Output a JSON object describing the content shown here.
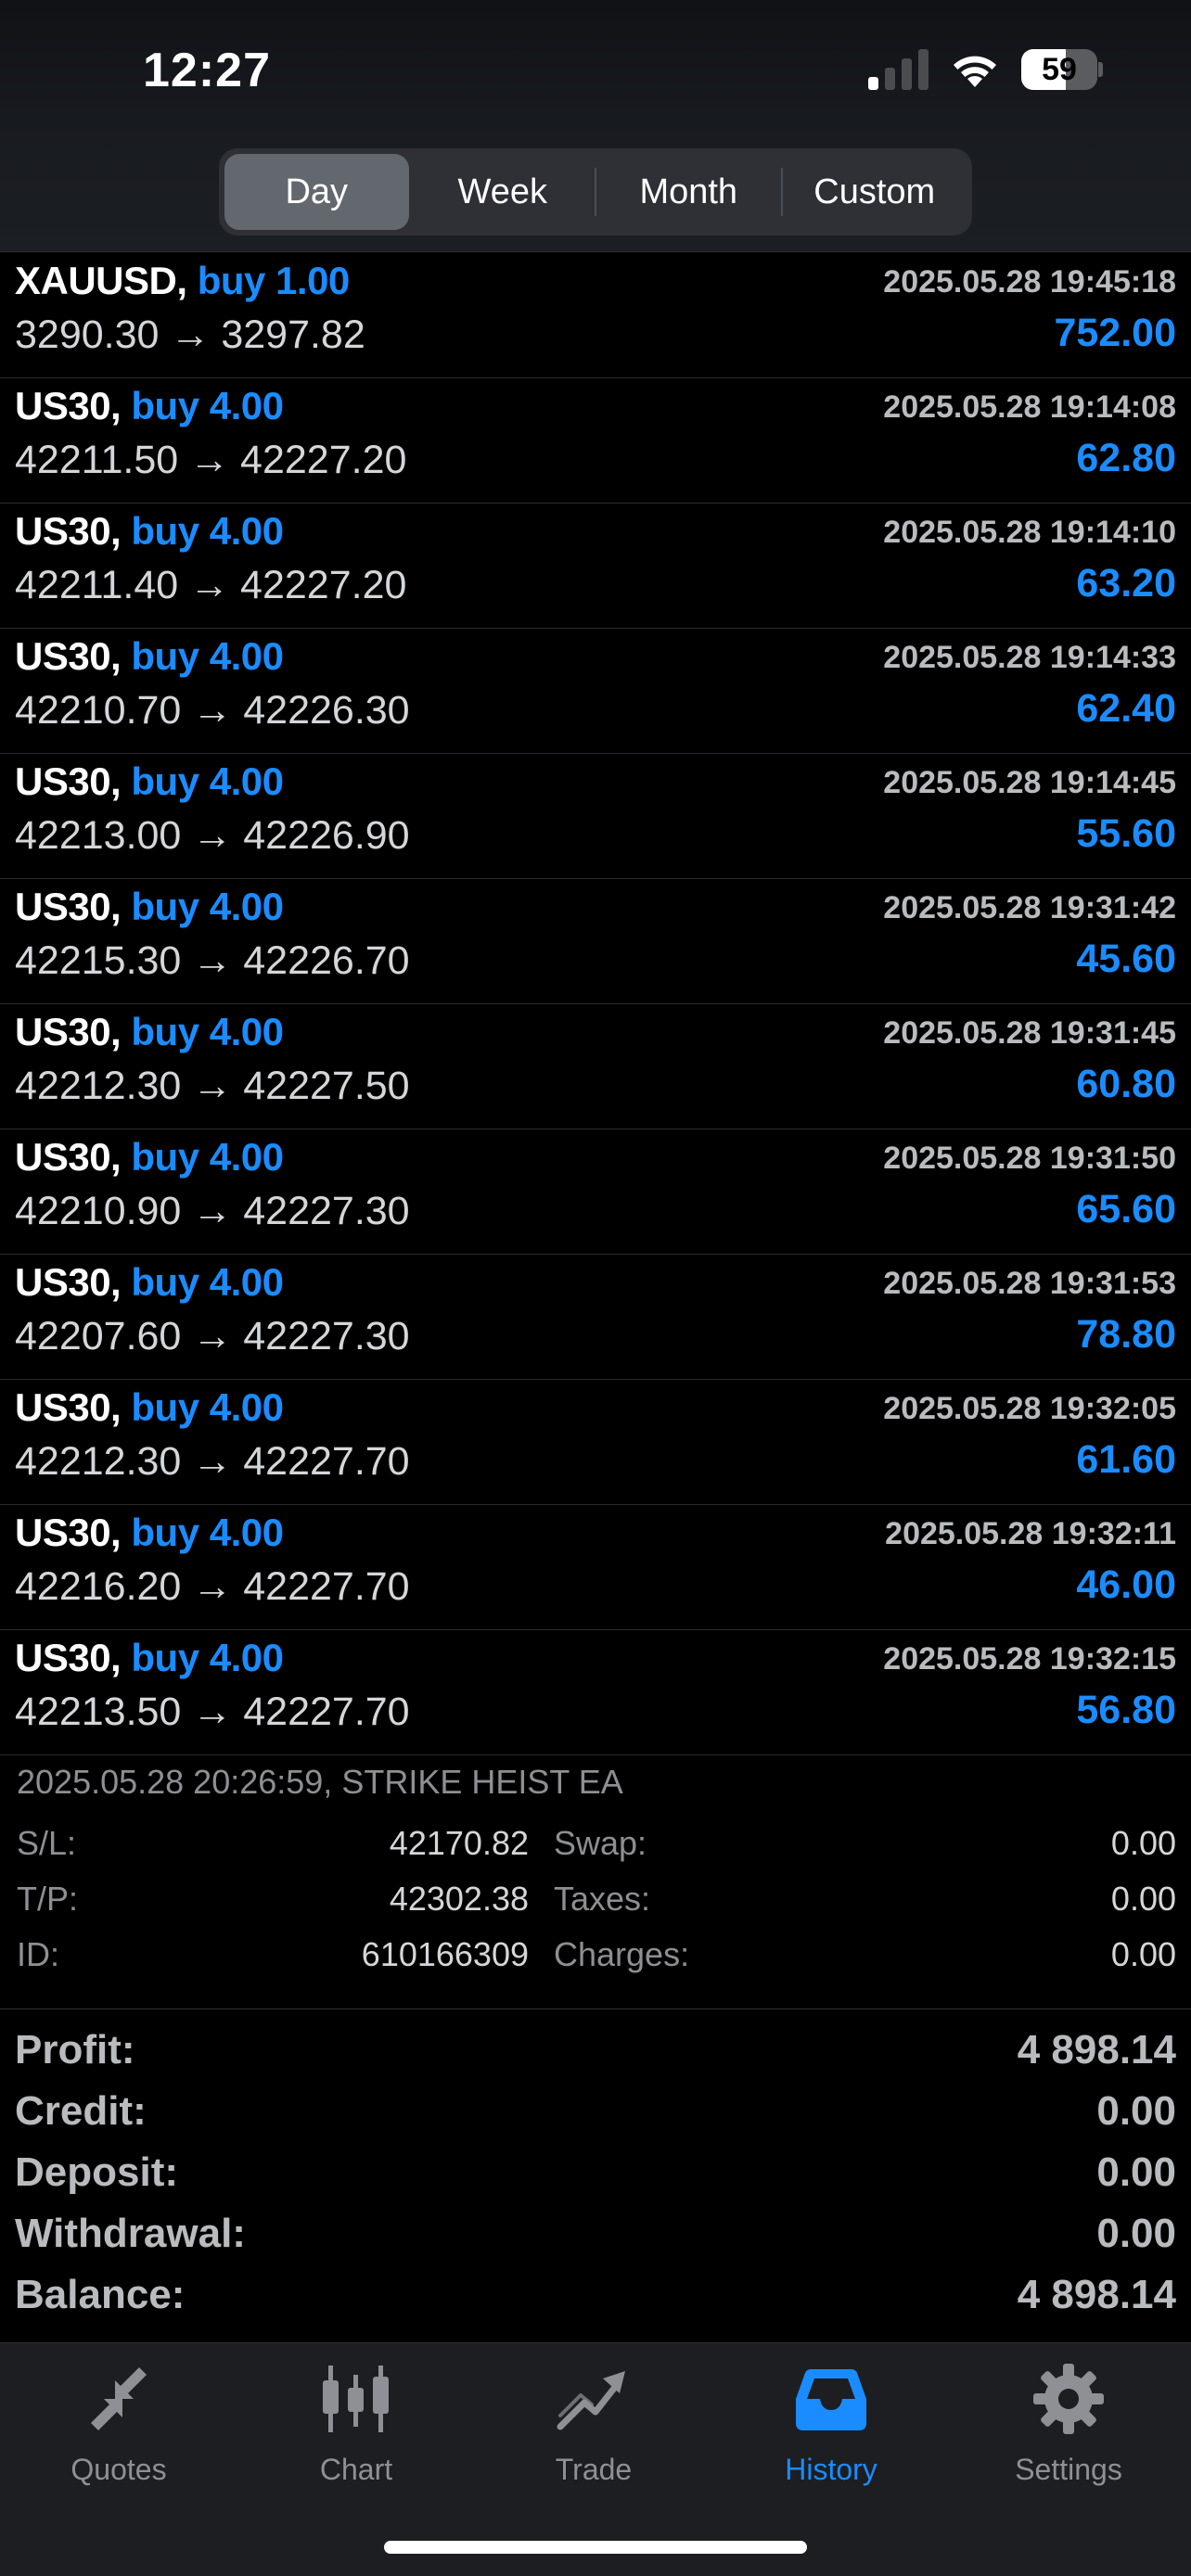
{
  "status_bar": {
    "time": "12:27",
    "battery": "59",
    "battery_level": 0.59
  },
  "period_tabs": [
    {
      "label": "Day",
      "active": true
    },
    {
      "label": "Week",
      "active": false
    },
    {
      "label": "Month",
      "active": false
    },
    {
      "label": "Custom",
      "active": false
    }
  ],
  "deals": [
    {
      "symbol": "XAUUSD,",
      "side": "buy 1.00",
      "time": "2025.05.28 19:45:18",
      "prices": "3290.30 → 3297.82",
      "profit": "752.00"
    },
    {
      "symbol": "US30,",
      "side": "buy 4.00",
      "time": "2025.05.28 19:14:08",
      "prices": "42211.50 → 42227.20",
      "profit": "62.80"
    },
    {
      "symbol": "US30,",
      "side": "buy 4.00",
      "time": "2025.05.28 19:14:10",
      "prices": "42211.40 → 42227.20",
      "profit": "63.20"
    },
    {
      "symbol": "US30,",
      "side": "buy 4.00",
      "time": "2025.05.28 19:14:33",
      "prices": "42210.70 → 42226.30",
      "profit": "62.40"
    },
    {
      "symbol": "US30,",
      "side": "buy 4.00",
      "time": "2025.05.28 19:14:45",
      "prices": "42213.00 → 42226.90",
      "profit": "55.60"
    },
    {
      "symbol": "US30,",
      "side": "buy 4.00",
      "time": "2025.05.28 19:31:42",
      "prices": "42215.30 → 42226.70",
      "profit": "45.60"
    },
    {
      "symbol": "US30,",
      "side": "buy 4.00",
      "time": "2025.05.28 19:31:45",
      "prices": "42212.30 → 42227.50",
      "profit": "60.80"
    },
    {
      "symbol": "US30,",
      "side": "buy 4.00",
      "time": "2025.05.28 19:31:50",
      "prices": "42210.90 → 42227.30",
      "profit": "65.60"
    },
    {
      "symbol": "US30,",
      "side": "buy 4.00",
      "time": "2025.05.28 19:31:53",
      "prices": "42207.60 → 42227.30",
      "profit": "78.80"
    },
    {
      "symbol": "US30,",
      "side": "buy 4.00",
      "time": "2025.05.28 19:32:05",
      "prices": "42212.30 → 42227.70",
      "profit": "61.60"
    },
    {
      "symbol": "US30,",
      "side": "buy 4.00",
      "time": "2025.05.28 19:32:11",
      "prices": "42216.20 → 42227.70",
      "profit": "46.00"
    },
    {
      "symbol": "US30,",
      "side": "buy 4.00",
      "time": "2025.05.28 19:32:15",
      "prices": "42213.50 → 42227.70",
      "profit": "56.80"
    }
  ],
  "details": {
    "meta": "2025.05.28 20:26:59, STRIKE HEIST EA",
    "rows": [
      {
        "k1": "S/L:",
        "v1": "42170.82",
        "k2": "Swap:",
        "v2": "0.00"
      },
      {
        "k1": "T/P:",
        "v1": "42302.38",
        "k2": "Taxes:",
        "v2": "0.00"
      },
      {
        "k1": "ID:",
        "v1": "610166309",
        "k2": "Charges:",
        "v2": "0.00"
      }
    ]
  },
  "summary": [
    {
      "label": "Profit:",
      "value": "4 898.14"
    },
    {
      "label": "Credit:",
      "value": "0.00"
    },
    {
      "label": "Deposit:",
      "value": "0.00"
    },
    {
      "label": "Withdrawal:",
      "value": "0.00"
    },
    {
      "label": "Balance:",
      "value": "4 898.14"
    }
  ],
  "tab_bar": [
    {
      "label": "Quotes",
      "icon": "quotes-arrows-icon",
      "active": false
    },
    {
      "label": "Chart",
      "icon": "candlestick-icon",
      "active": false
    },
    {
      "label": "Trade",
      "icon": "trade-trend-icon",
      "active": false
    },
    {
      "label": "History",
      "icon": "inbox-tray-icon",
      "active": true
    },
    {
      "label": "Settings",
      "icon": "gear-icon",
      "active": false
    }
  ],
  "colors": {
    "accent": "#1a8cff",
    "background": "#000000",
    "header_bg": "#1b1e23",
    "tabbar_bg": "#1d1e21",
    "muted_text": "#8d8f93"
  }
}
